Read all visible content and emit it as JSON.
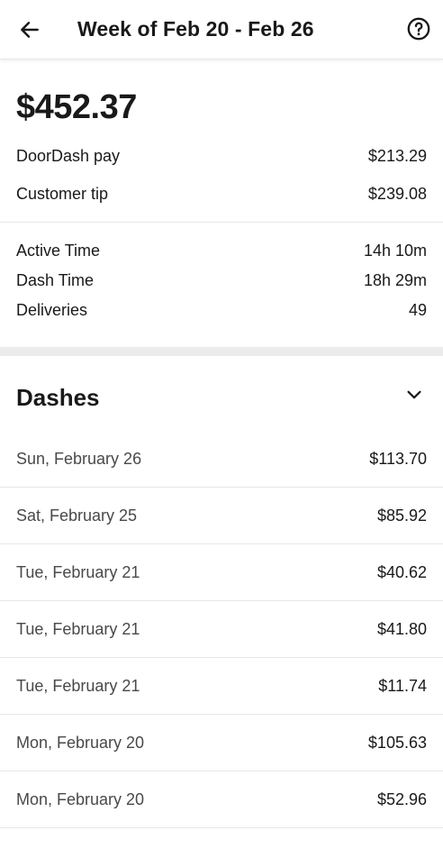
{
  "header": {
    "title": "Week of Feb 20 - Feb 26"
  },
  "summary": {
    "total": "$452.37",
    "breakdown": [
      {
        "label": "DoorDash pay",
        "value": "$213.29"
      },
      {
        "label": "Customer tip",
        "value": "$239.08"
      }
    ],
    "stats": [
      {
        "label": "Active Time",
        "value": "14h 10m"
      },
      {
        "label": "Dash Time",
        "value": "18h 29m"
      },
      {
        "label": "Deliveries",
        "value": "49"
      }
    ]
  },
  "dashes": {
    "title": "Dashes",
    "items": [
      {
        "date": "Sun, February 26",
        "amount": "$113.70"
      },
      {
        "date": "Sat, February 25",
        "amount": "$85.92"
      },
      {
        "date": "Tue, February 21",
        "amount": "$40.62"
      },
      {
        "date": "Tue, February 21",
        "amount": "$41.80"
      },
      {
        "date": "Tue, February 21",
        "amount": "$11.74"
      },
      {
        "date": "Mon, February 20",
        "amount": "$105.63"
      },
      {
        "date": "Mon, February 20",
        "amount": "$52.96"
      }
    ]
  },
  "icons": {
    "back": "arrow-left-icon",
    "help": "question-circle-icon",
    "collapse": "chevron-down-icon"
  }
}
